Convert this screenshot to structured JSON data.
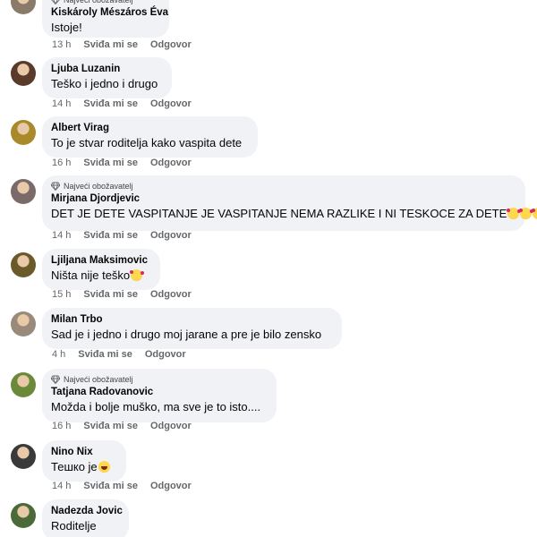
{
  "badge_label": "Najveći obožavatelj",
  "action_like": "Sviđa mi se",
  "action_reply": "Odgovor",
  "comments": [
    {
      "author": "Kiskároly Mészáros Éva",
      "text": "Istoje!",
      "time": "13 h",
      "badge_label": "Najveći obožavatelj",
      "avatar_color": "#8a7a6a"
    },
    {
      "author": "Ljuba Luzanin",
      "text": "Teško i jedno i drugo",
      "time": "14 h",
      "avatar_color": "#5a3a2a"
    },
    {
      "author": "Albert Virag",
      "text": "To je stvar roditelja kako vaspita dete",
      "time": "16 h",
      "avatar_color": "#a88a2a"
    },
    {
      "author": "Mirjana Djordjevic",
      "text": "DET JE DETE VASPITANJE JE VASPITANJE NEMA RAZLIKE I NI TESKOCE ZA DETE",
      "time": "14 h",
      "badge_label": "Najveći obožavatelj",
      "emoji": [
        "love",
        "love",
        "love"
      ],
      "avatar_color": "#7a6a6a"
    },
    {
      "author": "Ljiljana Maksimovic",
      "text": "Ništa nije teško",
      "time": "15 h",
      "emoji": [
        "love"
      ],
      "avatar_color": "#6a5a2a"
    },
    {
      "author": "Milan Trbo",
      "text": "Sad je i jedno i drugo moj jarane a pre je bilo zensko",
      "time": "4 h",
      "avatar_color": "#9a8a7a"
    },
    {
      "author": "Tatjana Radovanovic",
      "text": "Možda i bolje muško, ma sve je to isto....",
      "time": "16 h",
      "badge_label": "Najveći obožavatelj",
      "avatar_color": "#6a8a3a"
    },
    {
      "author": "Nino Nix",
      "text": "Тешко је",
      "time": "14 h",
      "emoji": [
        "laugh"
      ],
      "avatar_color": "#3a3a3a"
    },
    {
      "author": "Nadezda Jovic",
      "text": "Roditelje",
      "avatar_color": "#4a6a3a"
    }
  ]
}
